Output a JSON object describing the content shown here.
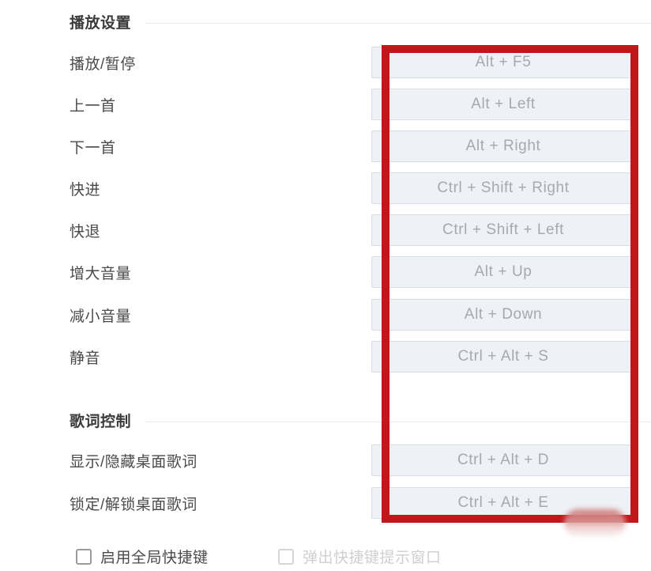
{
  "sections": [
    {
      "title": "播放设置",
      "rows": [
        {
          "label": "播放/暂停",
          "shortcut": "Alt + F5"
        },
        {
          "label": "上一首",
          "shortcut": "Alt + Left"
        },
        {
          "label": "下一首",
          "shortcut": "Alt + Right"
        },
        {
          "label": "快进",
          "shortcut": "Ctrl + Shift + Right"
        },
        {
          "label": "快退",
          "shortcut": "Ctrl + Shift + Left"
        },
        {
          "label": "增大音量",
          "shortcut": "Alt + Up"
        },
        {
          "label": "减小音量",
          "shortcut": "Alt + Down"
        },
        {
          "label": "静音",
          "shortcut": "Ctrl + Alt + S"
        }
      ]
    },
    {
      "title": "歌词控制",
      "rows": [
        {
          "label": "显示/隐藏桌面歌词",
          "shortcut": "Ctrl + Alt + D"
        },
        {
          "label": "锁定/解锁桌面歌词",
          "shortcut": "Ctrl + Alt + E"
        }
      ]
    }
  ],
  "checkboxes": [
    {
      "label": "启用全局快捷键",
      "checked": false,
      "disabled": false
    },
    {
      "label": "弹出快捷键提示窗口",
      "checked": false,
      "disabled": true
    }
  ],
  "annotation": {
    "color": "#c1171a",
    "shape": "rectangle-outline"
  },
  "colors": {
    "annotation_red": "#c1171a",
    "field_background": "#eef1f5",
    "field_border": "#d8dde3",
    "field_text": "#a7a9ac",
    "label_text": "#4a4a4a",
    "title_text": "#3b3b3b",
    "rule": "#e9ecef",
    "disabled_text": "#cfcfcf"
  }
}
